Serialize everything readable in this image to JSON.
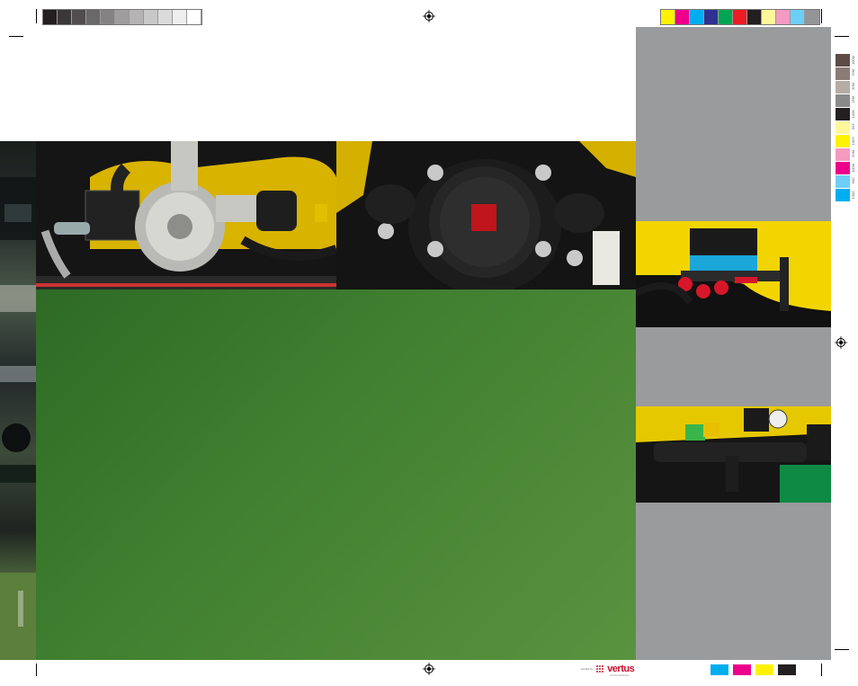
{
  "calibration": {
    "grey_swatches": [
      "#231f20",
      "#3a3738",
      "#514d4e",
      "#6b6869",
      "#858283",
      "#9f9d9e",
      "#b5b3b4",
      "#c9c8c8",
      "#dcdbdb",
      "#eeeeee",
      "#ffffff"
    ],
    "color_swatches": [
      "#fff200",
      "#ec008c",
      "#00aeef",
      "#2e3192",
      "#00a651",
      "#ed1c24",
      "#231f20",
      "#fff799",
      "#f49ac1",
      "#6dcff6",
      "#939598"
    ],
    "vertical_swatches": [
      "#5d4b47",
      "#8b7b76",
      "#b7aba6",
      "#8a8a8a",
      "#231f20",
      "#fff799",
      "#fff200",
      "#f49ac1",
      "#ec008c",
      "#6dcff6",
      "#00aeef"
    ],
    "vertical_labels": [
      "100M",
      "75M",
      "50M",
      "25M",
      "100K",
      "50Y",
      "100Y",
      "50M",
      "100M",
      "50C",
      "100C"
    ],
    "bottom_swatches": [
      "#00aeef",
      "#ec008c",
      "#fff200",
      "#231f20"
    ]
  },
  "panels": {
    "green_panel_color": "#3f7f2f",
    "side_panel_color": "#9a9b9c"
  },
  "photos": {
    "pump": "pump-photo",
    "diaphragm_pump": "diaphragm-pump-photo",
    "control_valves": "control-valves-photo",
    "pressure_manifold": "pressure-manifold-photo",
    "field_edge": "field-edge-photo"
  },
  "credit": {
    "prefix": "printed by",
    "brand": "vertus",
    "tagline": "communications"
  }
}
